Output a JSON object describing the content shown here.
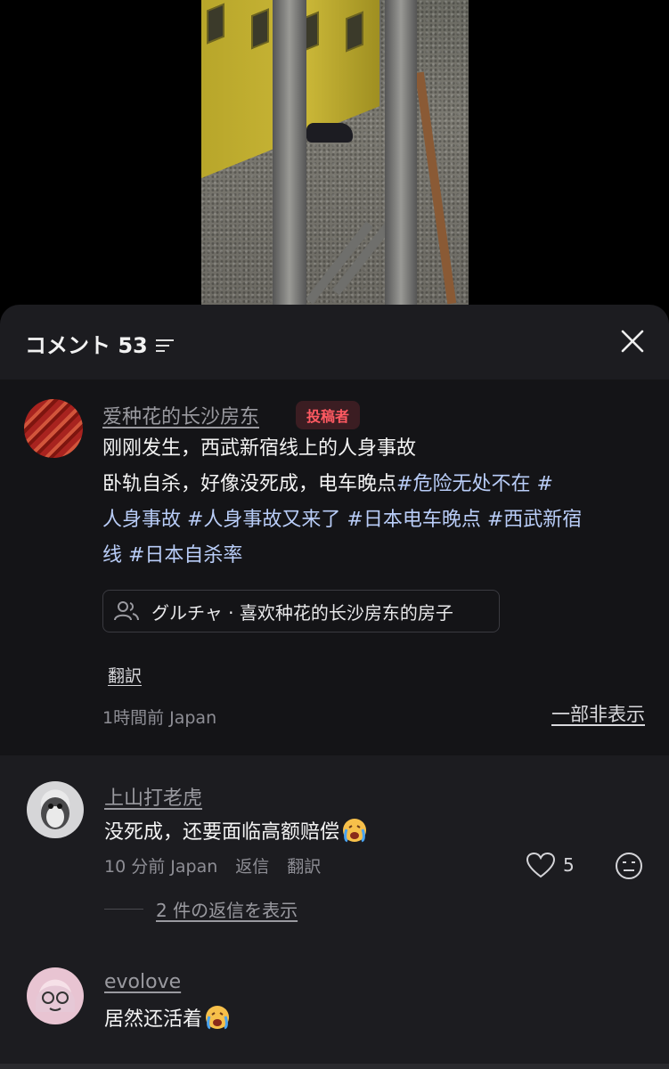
{
  "header": {
    "title": "コメント 53"
  },
  "post": {
    "author": "爱种花的长沙房东",
    "author_badge": "投稿者",
    "line1": "刚刚发生，西武新宿线上的人身事故",
    "line2_plain": "卧轨自杀，好像没死成，电车晚点",
    "line2_tag": "#危险无处不在",
    "line2_tag_tail": " #",
    "line3": "人身事故 #人身事故又来了 #日本电车晚点 #西武新宿",
    "line4": "线 #日本自杀率",
    "group_chat": "グルチャ · 喜欢种花的长沙房东的房子",
    "translate": "翻訳",
    "meta": "1時間前 Japan",
    "hide_label": "一部非表示"
  },
  "comments": [
    {
      "author": "上山打老虎",
      "text": "没死成，还要面临高额赔偿",
      "emoji": "crying-face-emoji",
      "time": "10 分前 Japan",
      "reply": "返信",
      "translate": "翻訳",
      "likes": "5",
      "replies_label": "2 件の返信を表示"
    },
    {
      "author": "evolove",
      "text": "居然还活着",
      "emoji": "crying-face-emoji"
    }
  ],
  "colors": {
    "sheet_bg": "#1c1c20",
    "post_bg": "#141417",
    "hashtag": "#b9cdf8",
    "badge_text": "#ff5a62",
    "badge_bg": "#3b1d22"
  }
}
